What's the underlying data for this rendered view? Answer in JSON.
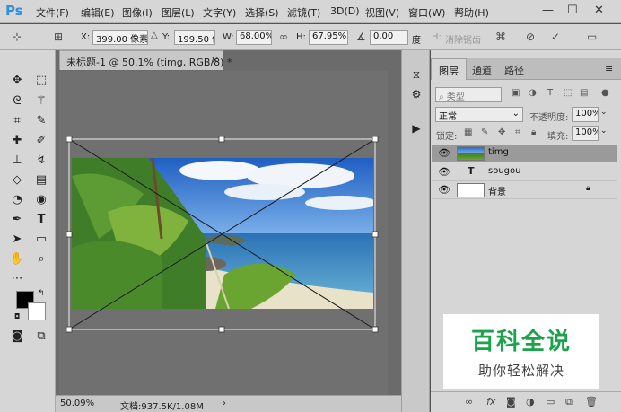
{
  "app": {
    "logo": "Ps"
  },
  "menu": [
    "文件(F)",
    "编辑(E)",
    "图像(I)",
    "图层(L)",
    "文字(Y)",
    "选择(S)",
    "滤镜(T)",
    "3D(D)",
    "视图(V)",
    "窗口(W)",
    "帮助(H)"
  ],
  "window_controls": {
    "minimize": "—",
    "maximize": "☐",
    "close": "✕"
  },
  "options": {
    "x_label": "X:",
    "x_value": "399.00 像素",
    "y_label": "Y:",
    "y_value": "199.50 像素",
    "w_label": "W:",
    "w_value": "68.00%",
    "h_label": "H:",
    "h_value": "67.95%",
    "angle_value": "0.00",
    "angle_unit": "度",
    "h_skew_label": "H:",
    "interp_label": "消除锯齿"
  },
  "document": {
    "tab_title": "未标题-1 @ 50.1% (timg, RGB/8) *",
    "close": "×",
    "zoom": "50.09%",
    "doc_info": "文档:937.5K/1.08M",
    "arrow": "›"
  },
  "layers_panel": {
    "tabs": [
      "图层",
      "通道",
      "路径"
    ],
    "filter_label": "类型",
    "blend_mode": "正常",
    "opacity_label": "不透明度:",
    "opacity_value": "100%",
    "lock_label": "锁定:",
    "fill_label": "填充:",
    "fill_value": "100%",
    "layers": [
      {
        "name": "timg",
        "selected": true,
        "type": "image"
      },
      {
        "name": "sougou",
        "selected": false,
        "type": "text",
        "type_glyph": "T"
      },
      {
        "name": "背景",
        "selected": false,
        "type": "background",
        "locked": true
      }
    ]
  },
  "watermark": {
    "title": "百科全说",
    "subtitle": "助你轻松解决"
  },
  "icons": {
    "move": "move-icon",
    "marquee": "marquee-icon",
    "lasso": "lasso-icon",
    "magic-wand": "magic-wand-icon",
    "crop": "crop-icon",
    "eyedropper": "eyedropper-icon",
    "brush": "brush-icon"
  },
  "colors": {
    "accent": "#2f8ee6",
    "watermark_green": "#1aa34a"
  }
}
